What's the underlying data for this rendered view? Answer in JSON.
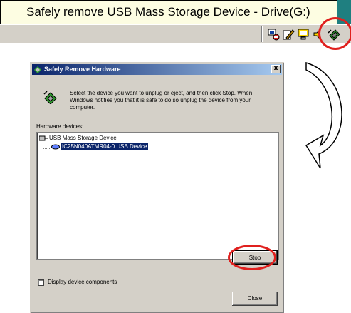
{
  "tooltip": {
    "text": "Safely remove USB Mass Storage Device - Drive(G:)"
  },
  "taskbar": {
    "tray_icons": [
      "network-icon",
      "pen-icon",
      "monitor-icon",
      "volume-icon",
      "safely-remove-hardware-icon"
    ]
  },
  "dialog": {
    "title": "Safely Remove Hardware",
    "close_glyph": "x",
    "instructions": "Select the device you want to unplug or eject, and then click Stop. When Windows notifies you that it is safe to do so unplug the device from your computer.",
    "hardware_label": "Hardware devices:",
    "devices": [
      {
        "label": "USB Mass Storage Device",
        "selected": false
      },
      {
        "label": "IC25N040ATMR04-0 USB Device",
        "selected": true
      }
    ],
    "stop_label": "Stop",
    "checkbox_label": "Display device components",
    "checkbox_checked": false,
    "close_label": "Close"
  },
  "colors": {
    "title_gradient_start": "#0a246a",
    "title_gradient_end": "#a6caf0",
    "highlight": "#e0201e",
    "tooltip_bg": "#fdfde2",
    "selection": "#0a246a"
  }
}
